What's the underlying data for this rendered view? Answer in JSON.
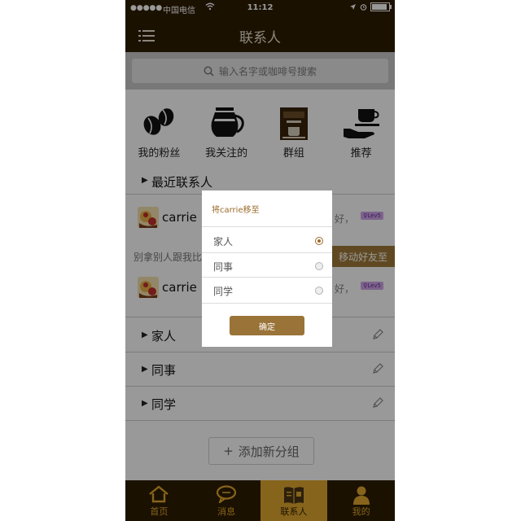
{
  "status_bar": {
    "signal": "●●●●●",
    "carrier": "中国电信",
    "time": "11:12"
  },
  "header": {
    "title": "联系人"
  },
  "search": {
    "placeholder": "输入名字或咖啡号搜索"
  },
  "categories": [
    {
      "label": "我的粉丝",
      "icon": "coffee-beans-icon"
    },
    {
      "label": "我关注的",
      "icon": "coffee-pot-icon"
    },
    {
      "label": "群组",
      "icon": "coffee-machine-icon"
    },
    {
      "label": "推荐",
      "icon": "coffee-serve-icon"
    }
  ],
  "recent": {
    "label": "最近联系人",
    "contacts": [
      {
        "name": "carrie",
        "preview": "好，",
        "level": "Lev5"
      },
      {
        "name": "carrie",
        "preview": "好，",
        "level": "Lev5"
      }
    ],
    "swipe_text": "别拿别人跟我比",
    "swipe_action": "移动好友至"
  },
  "groups": [
    {
      "label": "家人"
    },
    {
      "label": "同事"
    },
    {
      "label": "同学"
    }
  ],
  "add_group": "添加新分组",
  "tabs": [
    {
      "label": "首页",
      "icon": "home-icon",
      "active": false
    },
    {
      "label": "消息",
      "icon": "chat-bubble-icon",
      "active": false
    },
    {
      "label": "联系人",
      "icon": "contacts-book-icon",
      "active": true
    },
    {
      "label": "我的",
      "icon": "person-icon",
      "active": false
    }
  ],
  "dialog": {
    "title": "将carrie移至",
    "options": [
      {
        "label": "家人",
        "selected": true
      },
      {
        "label": "同事",
        "selected": false
      },
      {
        "label": "同学",
        "selected": false
      }
    ],
    "confirm": "确定"
  },
  "colors": {
    "brand_dark": "#2e1d02",
    "accent": "#e0a72d",
    "button": "#9a7338"
  }
}
